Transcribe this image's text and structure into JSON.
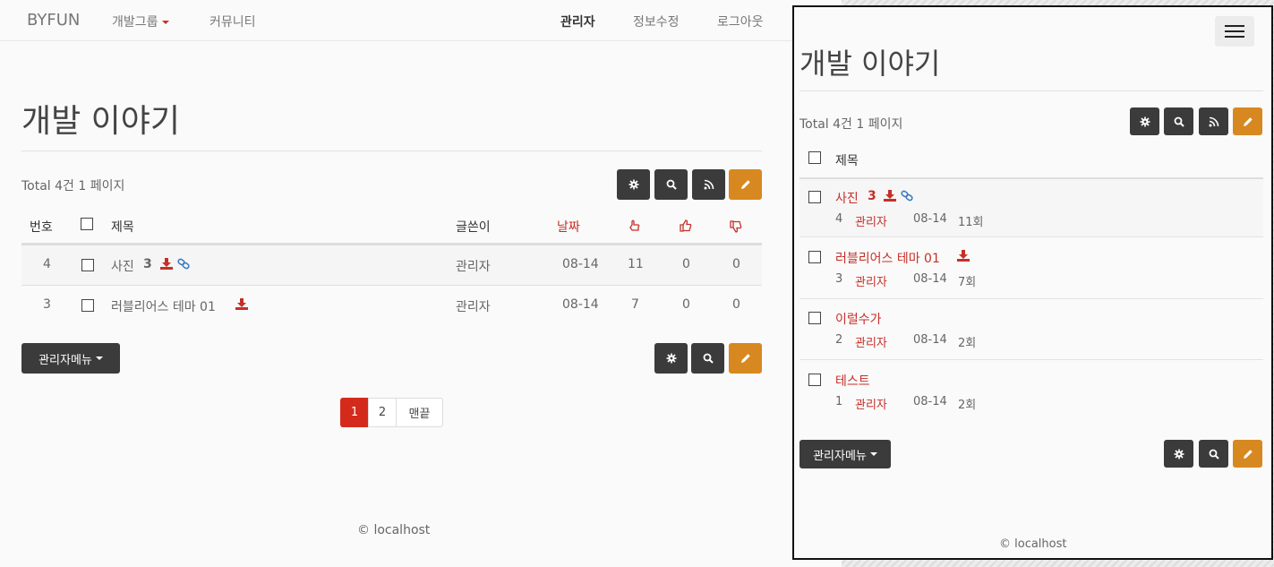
{
  "nav": {
    "brand": "BYFUN",
    "dev_group": "개발그룹",
    "community": "커뮤니티",
    "admin": "관리자",
    "edit_info": "정보수정",
    "logout": "로그아웃"
  },
  "page": {
    "title": "개발 이야기",
    "total": "Total 4건 1 페이지",
    "admin_menu": "관리자메뉴",
    "footer": "© localhost"
  },
  "table": {
    "headers": {
      "num": "번호",
      "subject": "제목",
      "writer": "글쓴이",
      "date": "날짜"
    },
    "rows": [
      {
        "num": "4",
        "subject": "사진",
        "comments": "3",
        "writer": "관리자",
        "date": "08-14",
        "views": "11",
        "good": "0",
        "bad": "0"
      },
      {
        "num": "3",
        "subject": "러블리어스 테마 01",
        "comments": "",
        "writer": "관리자",
        "date": "08-14",
        "views": "7",
        "good": "0",
        "bad": "0"
      }
    ]
  },
  "pagination": [
    "1",
    "2",
    "맨끝"
  ],
  "mobile": {
    "title": "개발 이야기",
    "total": "Total 4건 1 페이지",
    "subject_header": "제목",
    "rows": [
      {
        "subject": "사진",
        "comments": "3",
        "num": "4",
        "writer": "관리자",
        "date": "08-14",
        "views": "11회"
      },
      {
        "subject": "러블리어스 테마 01",
        "comments": "",
        "num": "3",
        "writer": "관리자",
        "date": "08-14",
        "views": "7회"
      },
      {
        "subject": "이럴수가",
        "comments": "",
        "num": "2",
        "writer": "관리자",
        "date": "08-14",
        "views": "2회"
      },
      {
        "subject": "테스트",
        "comments": "",
        "num": "1",
        "writer": "관리자",
        "date": "08-14",
        "views": "2회"
      }
    ],
    "admin_menu": "관리자메뉴",
    "footer": "© localhost"
  },
  "colors": {
    "accent_red": "#c62f28",
    "dark_button": "#3b3b3b",
    "write_button": "#d88820",
    "active_page": "#d42a1c"
  }
}
